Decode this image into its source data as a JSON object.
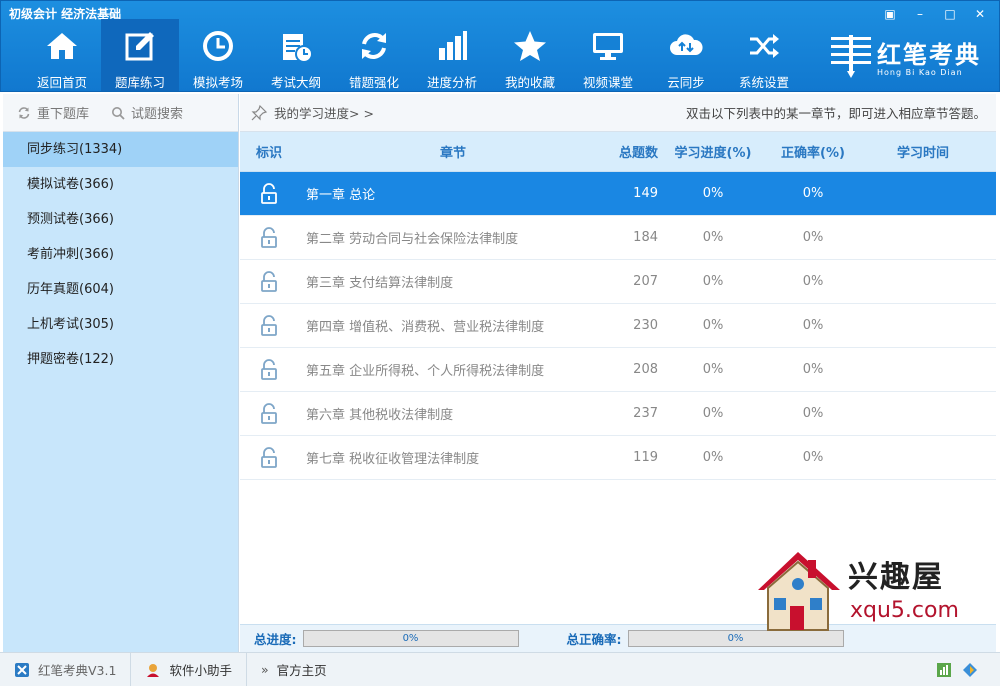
{
  "window": {
    "title": "初级会计 经济法基础",
    "controls": [
      "▣",
      "–",
      "□",
      "✕"
    ]
  },
  "toolbar": {
    "items": [
      {
        "label": "返回首页",
        "icon": "home-icon"
      },
      {
        "label": "题库练习",
        "icon": "edit-icon"
      },
      {
        "label": "模拟考场",
        "icon": "clock-icon"
      },
      {
        "label": "考试大纲",
        "icon": "syllabus-icon"
      },
      {
        "label": "错题强化",
        "icon": "refresh-icon"
      },
      {
        "label": "进度分析",
        "icon": "bar-chart-icon"
      },
      {
        "label": "我的收藏",
        "icon": "star-icon"
      },
      {
        "label": "视频课堂",
        "icon": "monitor-icon"
      },
      {
        "label": "云同步",
        "icon": "cloud-sync-icon"
      },
      {
        "label": "系统设置",
        "icon": "shuffle-icon"
      }
    ],
    "active_index": 1
  },
  "brand": {
    "cn": "红笔考典",
    "en": "Hong Bi Kao Dian"
  },
  "sidebar": {
    "tools": [
      {
        "label": "重下题库",
        "icon": "refresh-icon"
      },
      {
        "label": "试题搜索",
        "icon": "search-icon"
      }
    ],
    "items": [
      "同步练习(1334)",
      "模拟试卷(366)",
      "预测试卷(366)",
      "考前冲刺(366)",
      "历年真题(604)",
      "上机考试(305)",
      "押题密卷(122)"
    ]
  },
  "main": {
    "progress_link": "我的学习进度> >",
    "hint": "双击以下列表中的某一章节，即可进入相应章节答题。",
    "columns": [
      "标识",
      "章节",
      "总题数",
      "学习进度(%)",
      "正确率(%)",
      "学习时间"
    ],
    "rows": [
      {
        "chapter": "第一章 总论",
        "total": "149",
        "progress": "0%",
        "accuracy": "0%",
        "time": ""
      },
      {
        "chapter": "第二章 劳动合同与社会保险法律制度",
        "total": "184",
        "progress": "0%",
        "accuracy": "0%",
        "time": ""
      },
      {
        "chapter": "第三章 支付结算法律制度",
        "total": "207",
        "progress": "0%",
        "accuracy": "0%",
        "time": ""
      },
      {
        "chapter": "第四章 增值税、消费税、营业税法律制度",
        "total": "230",
        "progress": "0%",
        "accuracy": "0%",
        "time": ""
      },
      {
        "chapter": "第五章 企业所得税、个人所得税法律制度",
        "total": "208",
        "progress": "0%",
        "accuracy": "0%",
        "time": ""
      },
      {
        "chapter": "第六章 其他税收法律制度",
        "total": "237",
        "progress": "0%",
        "accuracy": "0%",
        "time": ""
      },
      {
        "chapter": "第七章 税收征收管理法律制度",
        "total": "119",
        "progress": "0%",
        "accuracy": "0%",
        "time": ""
      }
    ],
    "footer": {
      "total_progress_label": "总进度:",
      "total_progress_value": "0%",
      "total_accuracy_label": "总正确率:",
      "total_accuracy_value": "0%"
    }
  },
  "watermark": {
    "text": "兴趣屋",
    "url": "xqu5.com"
  },
  "statusbar": {
    "version": "红笔考典V3.1",
    "assistant": "软件小助手",
    "homepage": "官方主页"
  },
  "colors": {
    "header": "#1178cf",
    "selected_row": "#1a87e3",
    "sidebar": "#c8e6fb",
    "table_header": "#d7edfc"
  }
}
